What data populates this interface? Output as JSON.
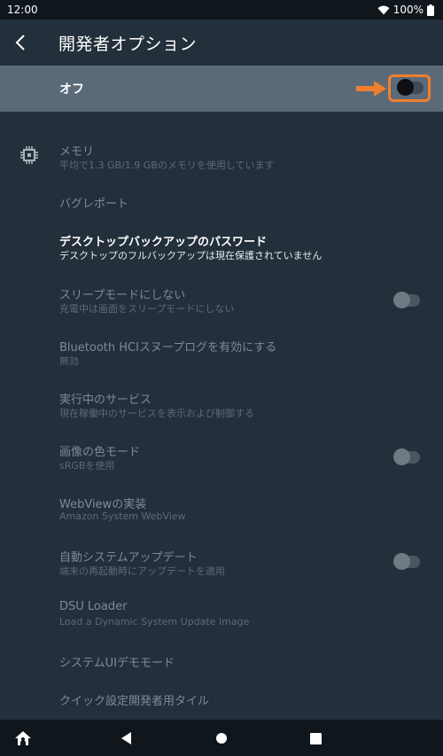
{
  "status_bar": {
    "time": "12:00",
    "battery": "100%",
    "icons": [
      "wifi-icon",
      "battery-icon"
    ]
  },
  "app_bar": {
    "title": "開発者オプション",
    "back_icon": "chevron-left-icon"
  },
  "master": {
    "label": "オフ",
    "toggle_on": false,
    "highlight_color": "#ef7f2d"
  },
  "items": [
    {
      "id": "memory",
      "title": "メモリ",
      "subtitle": "平均で1.3 GB/1.9 GBのメモリを使用しています",
      "icon": "memory-chip-icon",
      "toggle": null,
      "enabled": false
    },
    {
      "id": "bugreport",
      "title": "バグレポート",
      "subtitle": "",
      "toggle": null,
      "enabled": false
    },
    {
      "id": "desktop-password",
      "title": "デスクトップバックアップのパスワード",
      "subtitle": "デスクトップのフルバックアップは現在保護されていません",
      "toggle": null,
      "enabled": true
    },
    {
      "id": "stay-awake",
      "title": "スリープモードにしない",
      "subtitle": "充電中は画面をスリープモードにしない",
      "toggle": false,
      "enabled": false
    },
    {
      "id": "bt-hci",
      "title": "Bluetooth HCIスヌープログを有効にする",
      "subtitle": "無効",
      "toggle": null,
      "enabled": false
    },
    {
      "id": "running-services",
      "title": "実行中のサービス",
      "subtitle": "現在稼働中のサービスを表示および制御する",
      "toggle": null,
      "enabled": false
    },
    {
      "id": "color-mode",
      "title": "画像の色モード",
      "subtitle": "sRGBを使用",
      "toggle": false,
      "enabled": false
    },
    {
      "id": "webview",
      "title": "WebViewの実装",
      "subtitle": "Amazon System WebView",
      "toggle": null,
      "enabled": false
    },
    {
      "id": "auto-update",
      "title": "自動システムアップデート",
      "subtitle": "端末の再起動時にアップデートを適用",
      "toggle": false,
      "enabled": false
    },
    {
      "id": "dsu-loader",
      "title": "DSU Loader",
      "subtitle": "Load a Dynamic System Update Image",
      "toggle": null,
      "enabled": false
    },
    {
      "id": "sysui-demo",
      "title": "システムUIデモモード",
      "subtitle": "",
      "toggle": null,
      "enabled": false
    },
    {
      "id": "quick-tiles",
      "title": "クイック設定開発者用タイル",
      "subtitle": "",
      "toggle": null,
      "enabled": false
    }
  ],
  "nav_bar": {
    "icons": [
      "home-launcher-icon",
      "back-triangle-icon",
      "home-circle-icon",
      "recents-square-icon"
    ]
  },
  "colors": {
    "background": "#232f3a",
    "master_row": "#5b6a78",
    "disabled_text": "#7d8b97",
    "accent": "#ef7f2d"
  }
}
